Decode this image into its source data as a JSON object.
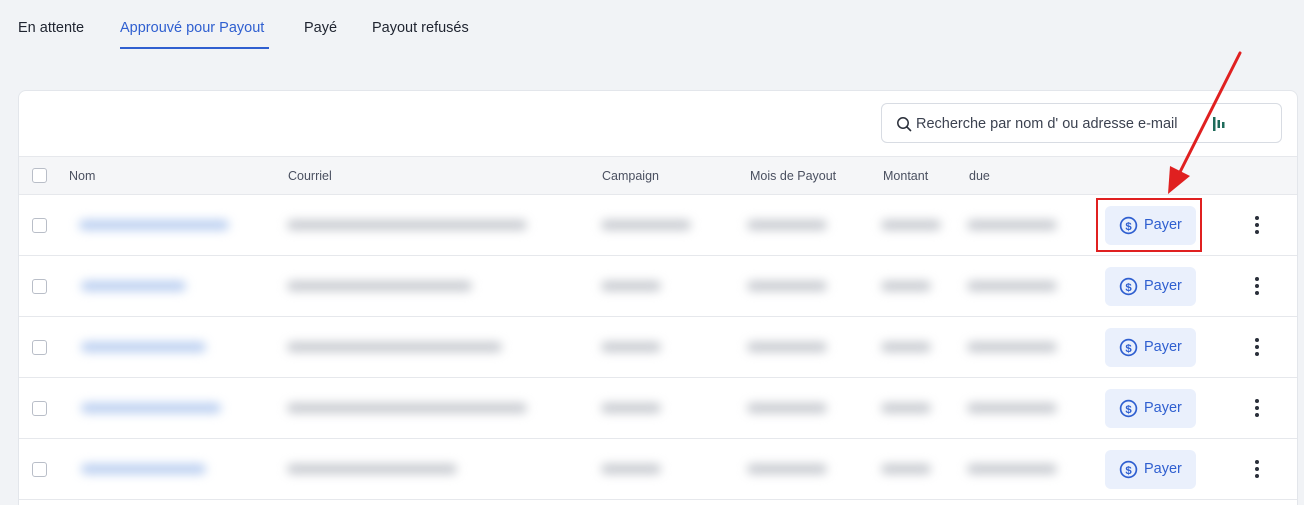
{
  "tabs": [
    {
      "label": "En attente",
      "active": false
    },
    {
      "label": "Approuvé pour Payout",
      "active": true
    },
    {
      "label": "Payé",
      "active": false
    },
    {
      "label": "Payout refusés",
      "active": false
    }
  ],
  "search": {
    "placeholder": "Recherche par nom d' ou adresse e-mail",
    "icon": "search-icon"
  },
  "columns": [
    "Nom",
    "Courriel",
    "Campaign",
    "Mois de Payout",
    "Montant",
    "due"
  ],
  "rows": [
    {
      "action_label": "Payer"
    },
    {
      "action_label": "Payer"
    },
    {
      "action_label": "Payer"
    },
    {
      "action_label": "Payer"
    },
    {
      "action_label": "Payer"
    }
  ],
  "colors": {
    "accent": "#2f5fd0",
    "highlight": "#e02020",
    "button_bg": "#eaf0fc"
  },
  "annotation": {
    "highlighted_row": 0,
    "type": "red-box-with-arrow"
  }
}
